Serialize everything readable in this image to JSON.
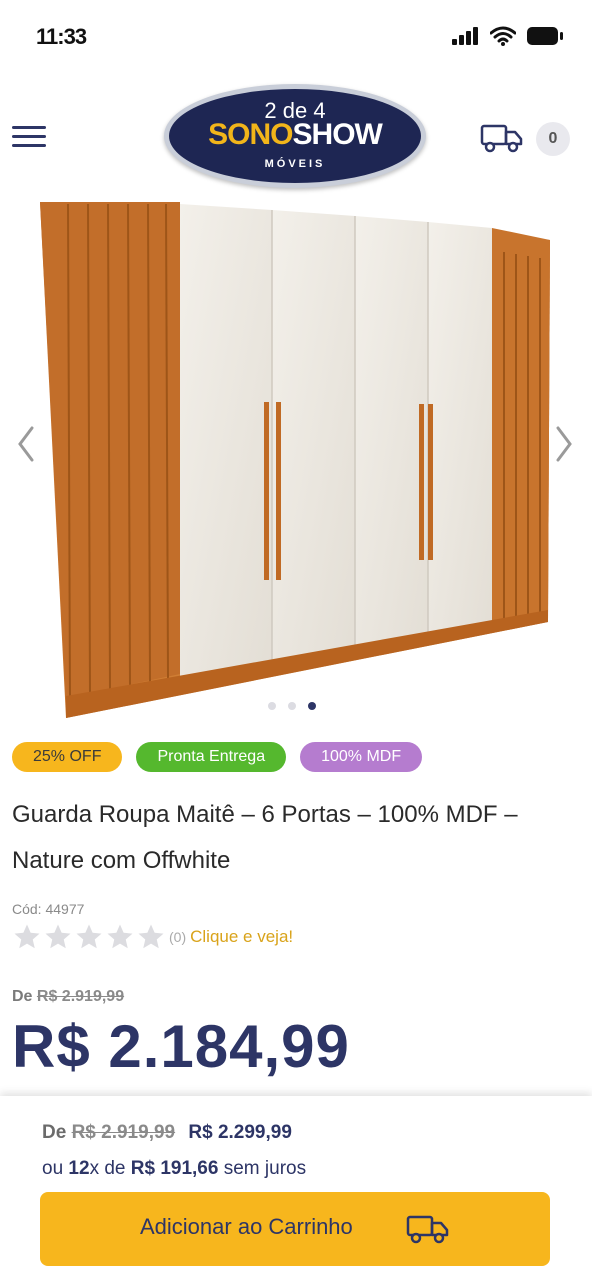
{
  "status_bar": {
    "time": "11:33"
  },
  "header": {
    "logo_counter": "2 de 4",
    "logo_brand_a": "SONO",
    "logo_brand_b": "SHOW",
    "logo_sub": "MÓVEIS",
    "cart_count": "0"
  },
  "gallery": {
    "dots_total": 3,
    "active_dot": 3
  },
  "badges": [
    {
      "label": "25% OFF",
      "color": "#f7b61d"
    },
    {
      "label": "Pronta Entrega",
      "color": "#55b82e"
    },
    {
      "label": "100% MDF",
      "color": "#b57ccf"
    }
  ],
  "product": {
    "title": "Guarda Roupa Maitê – 6 Portas – 100% MDF – Nature com Offwhite",
    "code": "Cód: 44977",
    "rating_count": "(0)",
    "rating_link": "Clique e veja!",
    "rating_stars": 0,
    "old_price_prefix": "De",
    "old_price": "R$ 2.919,99",
    "price": "R$ 2.184,99"
  },
  "bottom_bar": {
    "prefix": "De",
    "old_price": "R$ 2.919,99",
    "new_price": "R$ 2.299,99",
    "inst_prefix": "ou",
    "inst_count": "12",
    "inst_x": "x de",
    "inst_value": "R$ 191,66",
    "inst_suffix": "sem juros",
    "add_to_cart": "Adicionar ao Carrinho"
  },
  "colors": {
    "brand_navy": "#2d3566",
    "accent_yellow": "#f7b61d",
    "wood": "#c8752d",
    "offwhite": "#ede9e2"
  }
}
